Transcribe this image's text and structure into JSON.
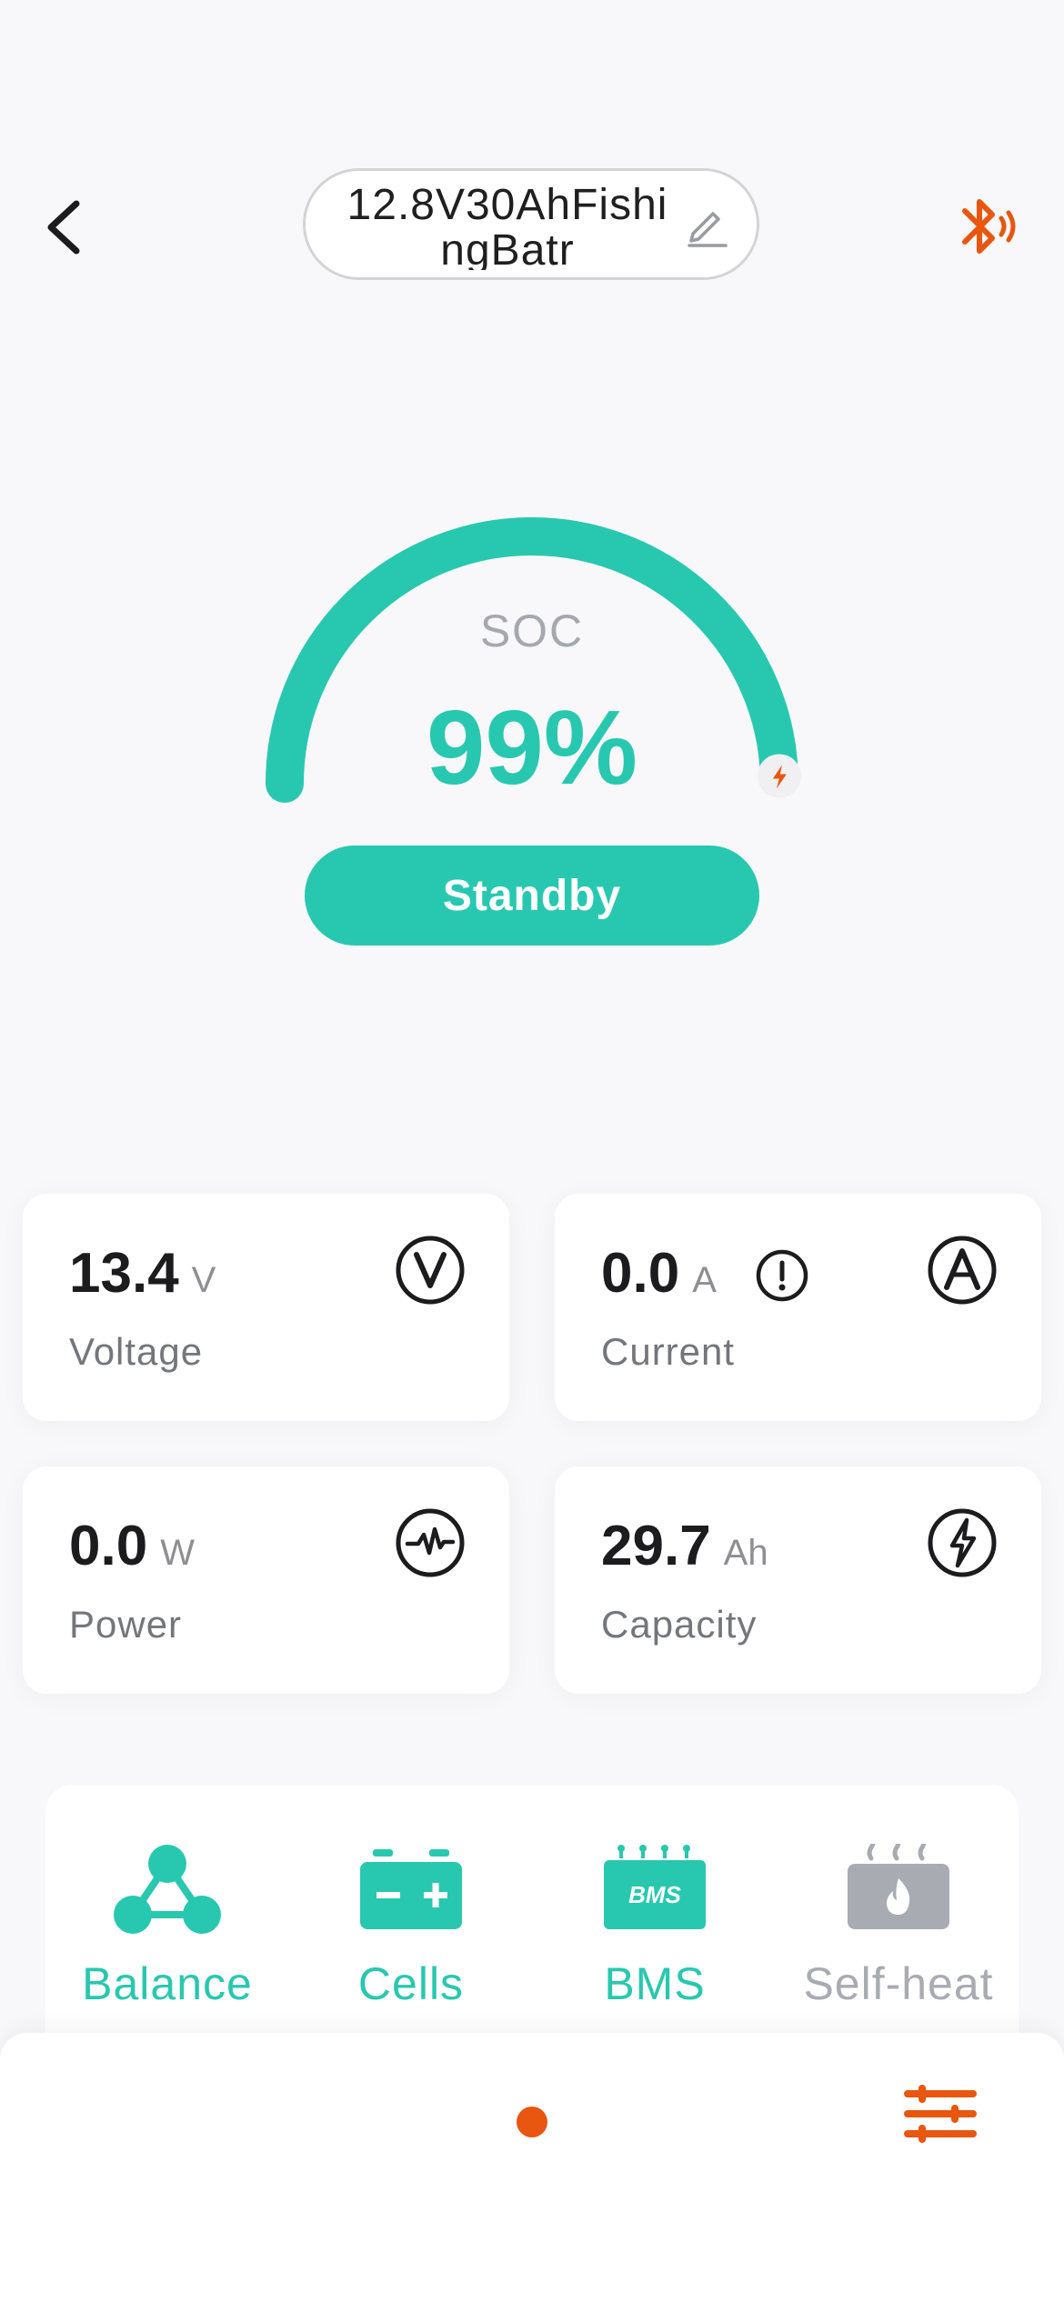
{
  "header": {
    "device_name": "12.8V30AhFishingBatr",
    "back_icon": "chevron-left-icon",
    "edit_icon": "pencil-icon",
    "bluetooth_icon": "bluetooth-connected-icon"
  },
  "gauge": {
    "label": "SOC",
    "value": "99%",
    "fill_fraction": 0.99,
    "status": "Standby"
  },
  "metrics": [
    {
      "value": "13.4",
      "unit": "V",
      "label": "Voltage",
      "icon": "voltage-icon"
    },
    {
      "value": "0.0",
      "unit": "A",
      "label": "Current",
      "icon": "ampere-icon"
    },
    {
      "value": "0.0",
      "unit": "W",
      "label": "Power",
      "icon": "power-pulse-icon"
    },
    {
      "value": "29.7",
      "unit": "Ah",
      "label": "Capacity",
      "icon": "lightning-icon"
    }
  ],
  "functions": [
    {
      "label": "Balance",
      "icon": "balance-nodes-icon"
    },
    {
      "label": "Cells",
      "icon": "battery-cells-icon"
    },
    {
      "label": "BMS",
      "icon": "bms-chip-icon"
    },
    {
      "label": "Self-heat",
      "icon": "self-heat-icon"
    }
  ],
  "colors": {
    "accent": "#28c8b0",
    "brand": "#e8560f",
    "disabled": "#a9abb3"
  }
}
